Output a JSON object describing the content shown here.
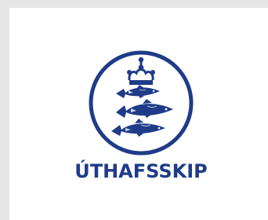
{
  "brand": {
    "name": "ÚTHAFSSKIP",
    "primary_color": "#1f3c88",
    "background_color": "#ffffff",
    "frame_color": "#e6e6e6"
  },
  "emblem": {
    "icon": "crown-and-three-fish-seal-icon"
  }
}
